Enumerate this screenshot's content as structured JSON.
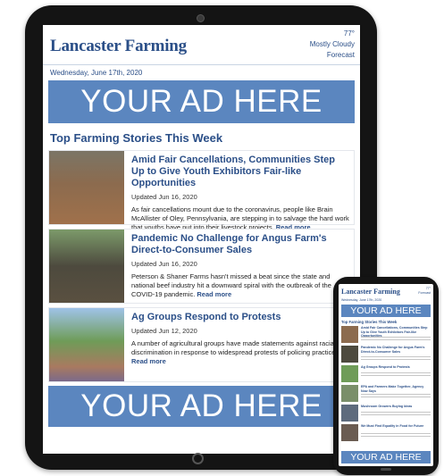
{
  "site": {
    "logo": "Lancaster Farming",
    "weather_temp": "77°",
    "weather_desc": "Mostly Cloudy",
    "forecast_link": "Forecast",
    "date": "Wednesday, June 17th, 2020"
  },
  "ads": {
    "label": "YOUR AD HERE"
  },
  "section_title": "Top Farming Stories This Week",
  "stories": [
    {
      "title": "Amid Fair Cancellations, Communities Step Up to Give Youth Exhibitors Fair-like Opportunities",
      "date": "Updated Jun 16, 2020",
      "body": "As fair cancellations mount due to the coronavirus, people like Brain McAllister of Oley, Pennsylvania, are stepping in to salvage the hard work that youths have put into their livestock projects.",
      "more": "Read more"
    },
    {
      "title": "Pandemic No Challenge for Angus Farm's Direct-to-Consumer Sales",
      "date": "Updated Jun 16, 2020",
      "body": "Peterson & Shaner Farms hasn't missed a beat since the state and national beef industry hit a downward spiral with the outbreak of the COVID-19 pandemic.",
      "more": "Read more"
    },
    {
      "title": "Ag Groups Respond to Protests",
      "date": "Updated Jun 12, 2020",
      "body": "A number of agricultural groups have made statements against racial discrimination in response to widespread protests of policing practices.",
      "more": "Read more"
    }
  ],
  "phone": {
    "logo": "Lancaster Farming",
    "ad_label": "YOUR AD HERE",
    "section_title": "Top Farming Stories This Week",
    "items": [
      "Amid Fair Cancellations, Communities Step Up to Give Youth Exhibitors Fair-like Opportunities",
      "Pandemic No Challenge for Angus Farm's Direct-to-Consumer Sales",
      "Ag Groups Respond to Protests",
      "EPA and Farmers Make Together, Agency Now Says",
      "Mushroom Growers Buying Ideas",
      "We Must Find Equality in Food for Future"
    ]
  }
}
